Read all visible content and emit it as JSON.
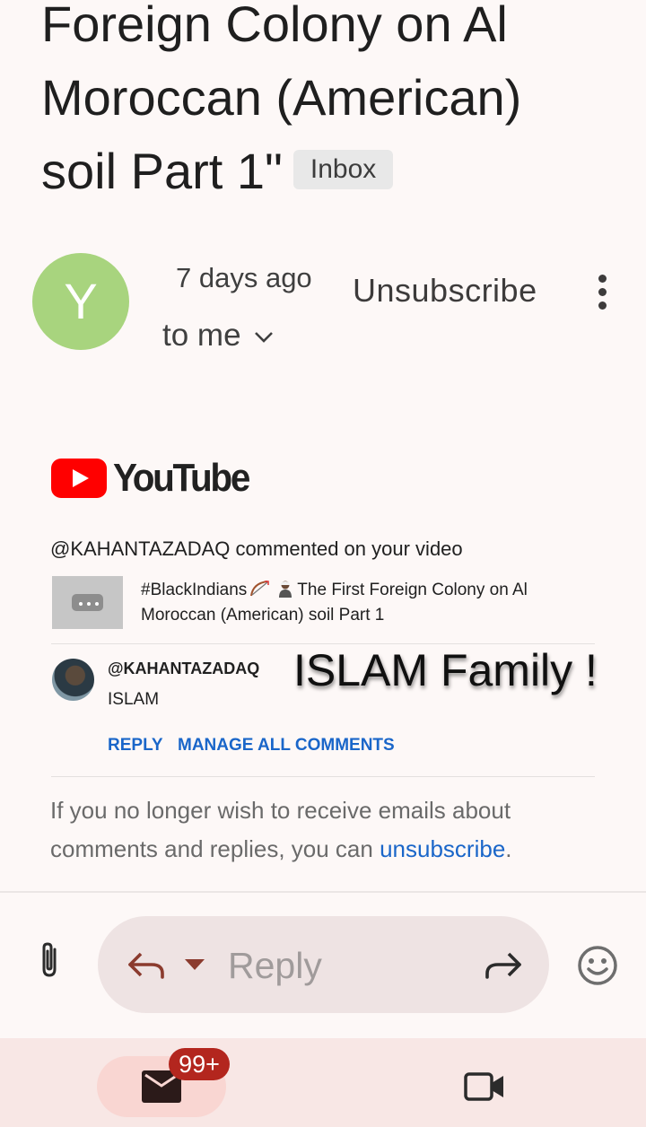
{
  "subject": {
    "line1": "Foreign Colony on Al",
    "line2": "Moroccan (American)",
    "line3": "soil Part 1\"",
    "label": "Inbox"
  },
  "sender": {
    "avatar_initial": "Y",
    "avatar_color": "#a8d47e",
    "time": "7 days ago",
    "recipient": "to me",
    "unsubscribe_label": "Unsubscribe"
  },
  "email": {
    "brand": "YouTube",
    "notice": "@KAHANTAZADAQ commented on your video",
    "video_title_1": "#BlackIndians",
    "video_title_2": "The First Foreign Colony on Al",
    "video_title_3": "Moroccan (American) soil Part 1",
    "comment_author": "@KAHANTAZADAQ",
    "comment_text": "ISLAM",
    "reply_label": "REPLY",
    "manage_label": "MANAGE ALL COMMENTS",
    "footer_text": "If you no longer wish to receive emails about comments and replies, you can ",
    "footer_link": "unsubscribe",
    "footer_end": "."
  },
  "overlay_text": "ISLAM Family !",
  "compose": {
    "placeholder": "Reply"
  },
  "bottom_nav": {
    "mail_badge": "99+"
  },
  "colors": {
    "link": "#1a66c9",
    "youtube_red": "#ff0000",
    "badge": "#b3261e"
  }
}
